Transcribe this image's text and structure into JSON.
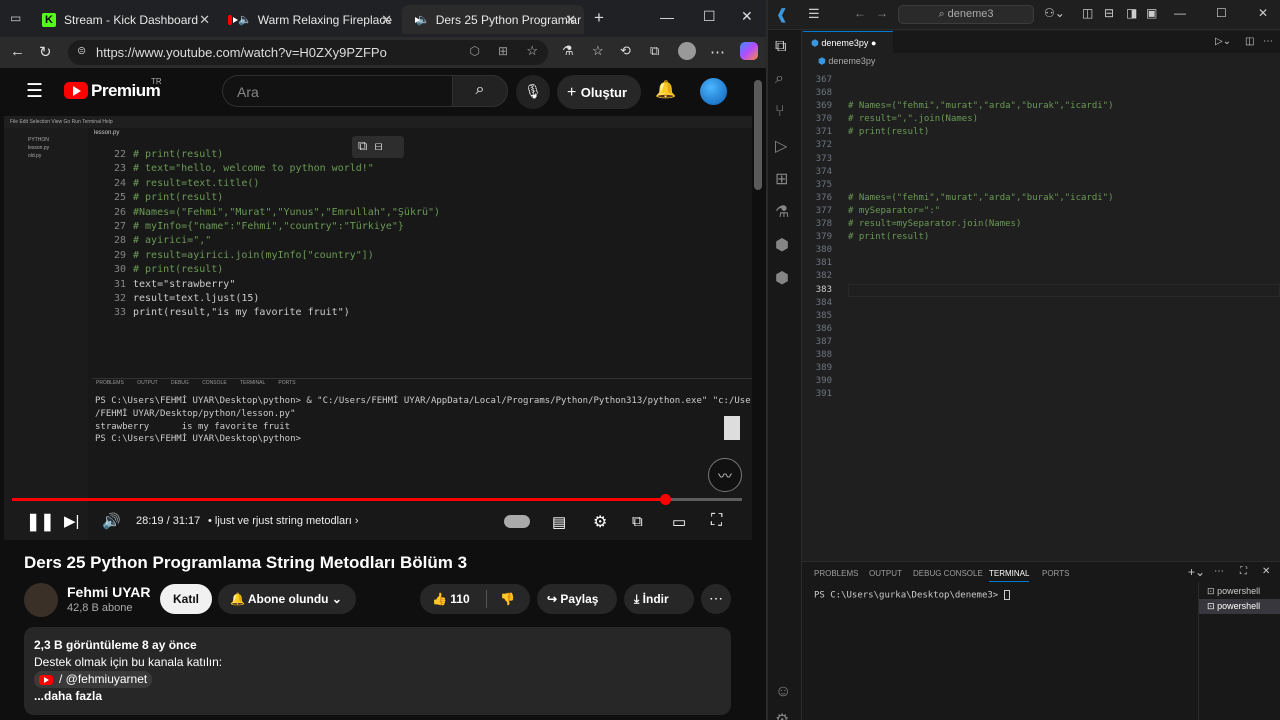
{
  "browser": {
    "tabs": [
      {
        "title": "Stream - Kick Dashboard",
        "favicon": "kick-icon"
      },
      {
        "title": "Warm Relaxing Fireplace",
        "favicon": "youtube-icon"
      },
      {
        "title": "Ders 25 Python Programlar",
        "favicon": "youtube-icon"
      }
    ],
    "url": "https://www.youtube.com/watch?v=H0ZXy9PZFPo"
  },
  "youtube": {
    "logo": "Premium",
    "region": "TR",
    "search_placeholder": "Ara",
    "create_label": "Oluştur",
    "player": {
      "time": "28:19 / 31:17",
      "chapter": "• ljust ve rjust string metodları",
      "progress": 0.895
    },
    "video_title": "Ders 25 Python Programlama String Metodları Bölüm 3",
    "channel": "Fehmi UYAR",
    "subscribers": "42,8 B abone",
    "join_label": "Katıl",
    "subscribed_label": "Abone olundu",
    "likes": "110",
    "share_label": "Paylaş",
    "download_label": "İndir",
    "views_line": "2,3 B görüntüleme  8 ay önce",
    "desc_line": "Destek olmak için bu kanala katılın:",
    "link_text": "/ @fehmiuyarnet",
    "more_label": "...daha fazla"
  },
  "lesson": {
    "tab": "lesson.py",
    "lines": [
      {
        "n": "22",
        "t": "# print(result)",
        "c": "cm"
      },
      {
        "n": "23",
        "t": "# text=\"hello, welcome to python world!\"",
        "c": "cm"
      },
      {
        "n": "24",
        "t": "# result=text.title()",
        "c": "cm"
      },
      {
        "n": "25",
        "t": "# print(result)",
        "c": "cm"
      },
      {
        "n": "26",
        "t": "#Names=(\"Fehmi\",\"Murat\",\"Yunus\",\"Emrullah\",\"Şükrü\")",
        "c": "cm"
      },
      {
        "n": "27",
        "t": "# myInfo={\"name\":\"Fehmi\",\"country\":\"Türkiye\"}",
        "c": "cm"
      },
      {
        "n": "28",
        "t": "# ayirici=\",\"",
        "c": "cm"
      },
      {
        "n": "29",
        "t": "# result=ayirici.join(myInfo[\"country\"])",
        "c": "cm"
      },
      {
        "n": "30",
        "t": "# print(result)",
        "c": "cm"
      },
      {
        "n": "31",
        "t": "text=\"strawberry\"",
        "c": "pl"
      },
      {
        "n": "32",
        "t": "result=text.ljust(15)",
        "c": "pl"
      },
      {
        "n": "33",
        "t": "print(result,\"is my favorite fruit\")",
        "c": "pl"
      }
    ],
    "term_tabs": [
      "PROBLEMS",
      "OUTPUT",
      "DEBUG CONSOLE",
      "TERMINAL",
      "PORTS"
    ],
    "terminal": [
      "PS C:\\Users\\FEHMİ UYAR\\Desktop\\python> & \"C:/Users/FEHMİ UYAR/AppData/Local/Programs/Python/Python313/python.exe\" \"c:/Users",
      "/FEHMİ UYAR/Desktop/python/lesson.py\"",
      "strawberry      is my favorite fruit",
      "PS C:\\Users\\FEHMİ UYAR\\Desktop\\python>"
    ]
  },
  "vscode": {
    "search": "deneme3",
    "tab": "deneme3py",
    "breadcrumb": "deneme3py",
    "lines": [
      {
        "n": "367",
        "t": ""
      },
      {
        "n": "368",
        "t": ""
      },
      {
        "n": "369",
        "t": "# Names=(\"fehmi\",\"murat\",\"arda\",\"burak\",\"icardi\")"
      },
      {
        "n": "370",
        "t": "# result=\",\".join(Names)"
      },
      {
        "n": "371",
        "t": "# print(result)"
      },
      {
        "n": "372",
        "t": ""
      },
      {
        "n": "373",
        "t": ""
      },
      {
        "n": "374",
        "t": ""
      },
      {
        "n": "375",
        "t": ""
      },
      {
        "n": "376",
        "t": "# Names=(\"fehmi\",\"murat\",\"arda\",\"burak\",\"icardi\")"
      },
      {
        "n": "377",
        "t": "# mySeparator=\":\""
      },
      {
        "n": "378",
        "t": "# result=mySeparator.join(Names)"
      },
      {
        "n": "379",
        "t": "# print(result)"
      },
      {
        "n": "380",
        "t": ""
      },
      {
        "n": "381",
        "t": ""
      },
      {
        "n": "382",
        "t": ""
      },
      {
        "n": "383",
        "t": ""
      },
      {
        "n": "384",
        "t": ""
      },
      {
        "n": "385",
        "t": ""
      },
      {
        "n": "386",
        "t": ""
      },
      {
        "n": "387",
        "t": ""
      },
      {
        "n": "388",
        "t": ""
      },
      {
        "n": "389",
        "t": ""
      },
      {
        "n": "390",
        "t": ""
      },
      {
        "n": "391",
        "t": ""
      }
    ],
    "panel_tabs": [
      "PROBLEMS",
      "OUTPUT",
      "DEBUG CONSOLE",
      "TERMINAL",
      "PORTS"
    ],
    "prompt": "PS C:\\Users\\gurka\\Desktop\\deneme3>",
    "shells": [
      "powershell",
      "powershell"
    ]
  }
}
